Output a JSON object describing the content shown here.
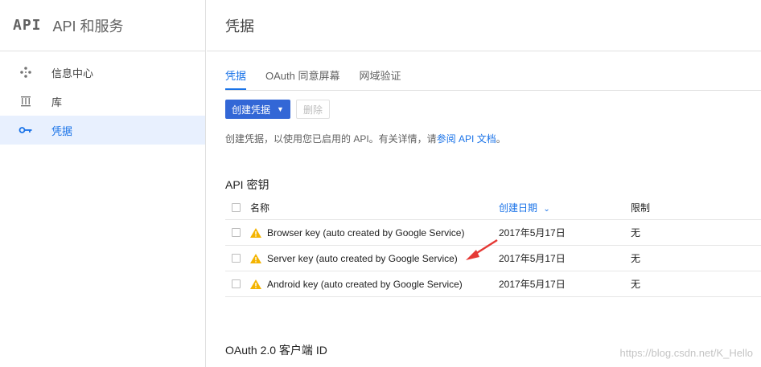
{
  "sidebar": {
    "logo": "API",
    "title": "API 和服务",
    "items": [
      {
        "label": "信息中心",
        "icon": "dashboard-icon"
      },
      {
        "label": "库",
        "icon": "library-icon"
      },
      {
        "label": "凭据",
        "icon": "key-icon"
      }
    ]
  },
  "page": {
    "title": "凭据"
  },
  "tabs": [
    "凭据",
    "OAuth 同意屏幕",
    "网域验证"
  ],
  "actions": {
    "create": "创建凭据",
    "delete": "删除"
  },
  "hint": {
    "prefix": "创建凭据，以使用您已启用的 API。有关详情，请",
    "link": "参阅 API 文档",
    "suffix": "。"
  },
  "api_keys": {
    "title": "API 密钥",
    "headers": {
      "name": "名称",
      "date": "创建日期",
      "limit": "限制"
    },
    "rows": [
      {
        "name": "Browser key (auto created by Google Service)",
        "date": "2017年5月17日",
        "limit": "无"
      },
      {
        "name": "Server key (auto created by Google Service)",
        "date": "2017年5月17日",
        "limit": "无"
      },
      {
        "name": "Android key (auto created by Google Service)",
        "date": "2017年5月17日",
        "limit": "无"
      }
    ]
  },
  "oauth": {
    "title": "OAuth 2.0 客户端 ID"
  },
  "watermark": "https://blog.csdn.net/K_Hello",
  "colors": {
    "accent": "#1a73e8",
    "primary_button": "#3367d6",
    "warning": "#f4b400",
    "annotation_arrow": "#e53935"
  }
}
